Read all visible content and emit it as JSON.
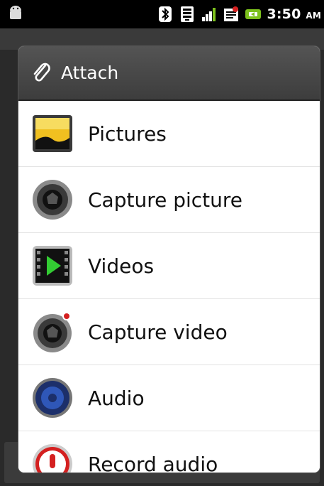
{
  "status_bar": {
    "time": "3:50",
    "ampm": "AM",
    "icons": [
      "android-icon",
      "bluetooth-icon",
      "wifi-icon",
      "signal-icon",
      "sms-icon",
      "battery-icon"
    ]
  },
  "dialog": {
    "title": "Attach",
    "title_icon": "paperclip-icon",
    "items": [
      {
        "label": "Pictures",
        "icon": "pictures-icon"
      },
      {
        "label": "Capture picture",
        "icon": "camera-icon"
      },
      {
        "label": "Videos",
        "icon": "video-play-icon"
      },
      {
        "label": "Capture video",
        "icon": "camcorder-icon"
      },
      {
        "label": "Audio",
        "icon": "speaker-icon"
      },
      {
        "label": "Record audio",
        "icon": "microphone-icon"
      }
    ]
  },
  "colors": {
    "title_bar": "#454545",
    "accent_green": "#7dc11d",
    "record_red": "#d42020",
    "audio_blue": "#2f57b8"
  }
}
